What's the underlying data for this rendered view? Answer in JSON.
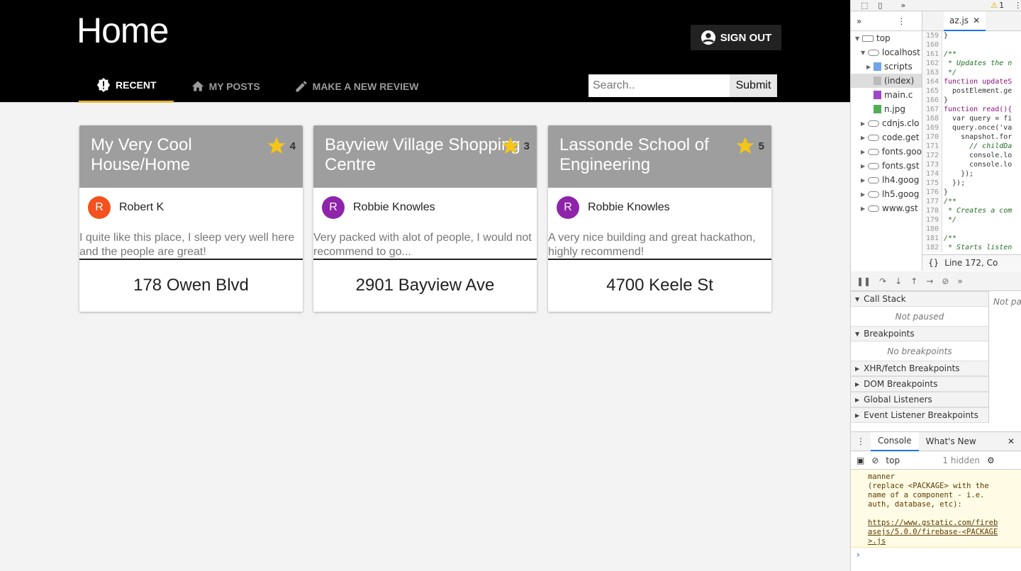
{
  "header": {
    "title": "Home",
    "signout_label": "SIGN OUT"
  },
  "tabs": [
    {
      "label": "RECENT",
      "icon": "alert-badge-icon",
      "active": true
    },
    {
      "label": "MY POSTS",
      "icon": "home-icon",
      "active": false
    },
    {
      "label": "MAKE A NEW REVIEW",
      "icon": "pencil-icon",
      "active": false
    }
  ],
  "search": {
    "placeholder": "Search..",
    "value": "",
    "submit_label": "Submit"
  },
  "cards": [
    {
      "title": "My Very Cool House/Home",
      "rating": "4",
      "author_initial": "R",
      "author": "Robert K",
      "avatar_color": "#f4511e",
      "description": "I quite like this place, I sleep very well here and the people are great!",
      "address": "178 Owen Blvd"
    },
    {
      "title": "Bayview Village Shopping Centre",
      "rating": "3",
      "author_initial": "R",
      "author": "Robbie Knowles",
      "avatar_color": "#8e24aa",
      "description": "Very packed with alot of people, I would not recommend to go...",
      "address": "2901 Bayview Ave"
    },
    {
      "title": "Lassonde School of Engineering",
      "rating": "5",
      "author_initial": "R",
      "author": "Robbie Knowles",
      "avatar_color": "#8e24aa",
      "description": "A very nice building and great hackathon, highly recommend!",
      "address": "4700 Keele St"
    }
  ],
  "colors": {
    "star": "#f5c518",
    "tab_underline": "#e8b232",
    "card_header": "#9e9e9e"
  },
  "devtools": {
    "top_warning": "1",
    "tree": [
      {
        "label": "top",
        "arrow": "▼",
        "icon": "frame-icon"
      },
      {
        "label": "localhost",
        "arrow": "▼",
        "icon": "cloud-icon"
      },
      {
        "label": "scripts",
        "arrow": "▶",
        "icon": "folder-icon"
      },
      {
        "label": "(index)",
        "arrow": "",
        "icon": "file-icon",
        "selected": true
      },
      {
        "label": "main.c",
        "arrow": "",
        "icon": "css-file-icon"
      },
      {
        "label": "n.jpg",
        "arrow": "",
        "icon": "image-file-icon"
      },
      {
        "label": "cdnjs.clo",
        "arrow": "▶",
        "icon": "cloud-icon"
      },
      {
        "label": "code.get",
        "arrow": "▶",
        "icon": "cloud-icon"
      },
      {
        "label": "fonts.goo",
        "arrow": "▶",
        "icon": "cloud-icon"
      },
      {
        "label": "fonts.gst",
        "arrow": "▶",
        "icon": "cloud-icon"
      },
      {
        "label": "lh4.goog",
        "arrow": "▶",
        "icon": "cloud-icon"
      },
      {
        "label": "lh5.goog",
        "arrow": "▶",
        "icon": "cloud-icon"
      },
      {
        "label": "www.gst",
        "arrow": "▶",
        "icon": "cloud-icon"
      }
    ],
    "file_tab": "az.js",
    "code": [
      {
        "n": "159",
        "t": "}",
        "c": ""
      },
      {
        "n": "160",
        "t": "",
        "c": ""
      },
      {
        "n": "161",
        "t": "/**",
        "c": "cm"
      },
      {
        "n": "162",
        "t": " * Updates the n",
        "c": "cm"
      },
      {
        "n": "163",
        "t": " */",
        "c": "cm"
      },
      {
        "n": "164",
        "t": "function updateS",
        "c": "kw"
      },
      {
        "n": "165",
        "t": "  postElement.ge",
        "c": ""
      },
      {
        "n": "166",
        "t": "}",
        "c": ""
      },
      {
        "n": "167",
        "t": "function read(){",
        "c": "kw"
      },
      {
        "n": "168",
        "t": "  var query = fi",
        "c": ""
      },
      {
        "n": "169",
        "t": "  query.once('va",
        "c": ""
      },
      {
        "n": "170",
        "t": "    snapshot.for",
        "c": ""
      },
      {
        "n": "171",
        "t": "      // childDa",
        "c": "cm"
      },
      {
        "n": "172",
        "t": "      console.lo",
        "c": ""
      },
      {
        "n": "173",
        "t": "      console.lo",
        "c": ""
      },
      {
        "n": "174",
        "t": "    });",
        "c": ""
      },
      {
        "n": "175",
        "t": "  });",
        "c": ""
      },
      {
        "n": "176",
        "t": "}",
        "c": ""
      },
      {
        "n": "177",
        "t": "/**",
        "c": "cm"
      },
      {
        "n": "178",
        "t": " * Creates a com",
        "c": "cm"
      },
      {
        "n": "179",
        "t": " */",
        "c": "cm"
      },
      {
        "n": "180",
        "t": "",
        "c": ""
      },
      {
        "n": "181",
        "t": "/**",
        "c": "cm"
      },
      {
        "n": "182",
        "t": " * Starts listen",
        "c": "cm"
      }
    ],
    "status_line": "Line 172, Co",
    "call_stack": "Call Stack",
    "not_paused": "Not paused",
    "breakpoints": "Breakpoints",
    "no_breakpoints": "No breakpoints",
    "xhr": "XHR/fetch Breakpoints",
    "dom": "DOM Breakpoints",
    "global": "Global Listeners",
    "event": "Event Listener Breakpoints",
    "scope_text": "Not pa",
    "console_tab": "Console",
    "whats_new_tab": "What's New",
    "context": "top",
    "hidden": "1 hidden",
    "console_message": "manner\n(replace <PACKAGE> with the\nname of a component - i.e.\nauth, database, etc):\n\n",
    "console_link": "https://www.gstatic.com/fireb\nasejs/5.0.0/firebase-<PACKAGE\n>.js"
  }
}
